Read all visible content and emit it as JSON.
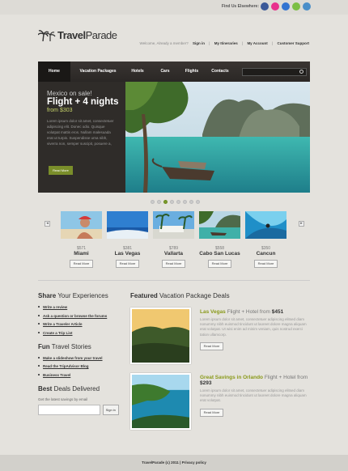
{
  "header": {
    "find_us": "Find Us Elsewhere:",
    "social_icons": [
      {
        "name": "facebook-icon",
        "color": "#3b5998"
      },
      {
        "name": "flickr-icon",
        "color": "#e8308c"
      },
      {
        "name": "delicious-icon",
        "color": "#3274d1"
      },
      {
        "name": "stumbleupon-icon",
        "color": "#7cbf45"
      },
      {
        "name": "rss-icon",
        "color": "#4b8fc9"
      }
    ],
    "logo_bold": "Travel",
    "logo_rest": "Parade",
    "welcome": "Welcome, Already a member?",
    "links": [
      "Sign in",
      "My Itineraries",
      "My Account",
      "Customer Support"
    ]
  },
  "nav": {
    "items": [
      "Home",
      "Vacation Packages",
      "Hotels",
      "Cars",
      "Flights",
      "Contacts"
    ],
    "active": "Home"
  },
  "slide": {
    "kicker": "Mexico on sale!",
    "headline": "Flight + 4 nights",
    "price": "from $303",
    "body": "Lorem ipsum dolor sit amet, consectetuer adipiscing elit. Donec odio. Quisque volutpat mattis eros. Nullam malesuada erat ut turpis. Suspendisse urna nibh, viverra non, semper suscipit, posuere a, pede. Donec nec justo eget felis facilisis fermentum. Aliquam porttitor mauris sit amet orci. Aenean dignissim pellentesque felis.",
    "button": "Read More",
    "dots_count": 8,
    "active_dot": 2
  },
  "destinations": [
    {
      "price": "$571",
      "name": "Miami",
      "button": "Read More"
    },
    {
      "price": "$381",
      "name": "Las Vegas",
      "button": "Read More"
    },
    {
      "price": "$789",
      "name": "Vallarta",
      "button": "Read More"
    },
    {
      "price": "$558",
      "name": "Cabo San Lucas",
      "button": "Read More"
    },
    {
      "price": "$350",
      "name": "Cancun",
      "button": "Read More"
    }
  ],
  "share": {
    "title_bold": "Share",
    "title_rest": " Your Experiences",
    "links": [
      "Write a review",
      "Ask a question or browse the forums",
      "Write a Traveler Article",
      "Create a Trip List"
    ]
  },
  "stories": {
    "title_bold": "Fun",
    "title_rest": " Travel Stories",
    "links": [
      "Make a slideshow from your travel",
      "Read the TripAdvisor Blog",
      "Business Travel"
    ]
  },
  "deals_signup": {
    "title_bold": "Best",
    "title_rest": " Deals Delivered",
    "caption": "Get the latest savings by email",
    "button": "Sign in"
  },
  "featured": {
    "title_bold": "Featured",
    "title_rest": " Vacation Package Deals",
    "deals": [
      {
        "lead": "Las Vegas",
        "mid": " Flight + Hotel from ",
        "price": "$451",
        "desc": "Lorem ipsum dolor sit amet, consectetuer adipiscing elitsed diam nonummy nibh euismod tincidunt ut laoreet dolore magna aliquam erat volutpat. Ut wisi enim ad minim veniam, quis nostrud exerci tation ullamcorp.",
        "button": "Read More"
      },
      {
        "lead": "Great Savings in Orlando",
        "mid": " Flight + Hotel from ",
        "price": "$293",
        "desc": "Lorem ipsum dolor sit amet, consectetuer adipiscing elitsed diam nonummy nibh euismod tincidunt ut laoreet dolore magna aliquam erat volutpat.",
        "button": "Read More"
      }
    ]
  },
  "footer": {
    "text": "TravelParade (c) 2011  |  Privacy policy"
  }
}
